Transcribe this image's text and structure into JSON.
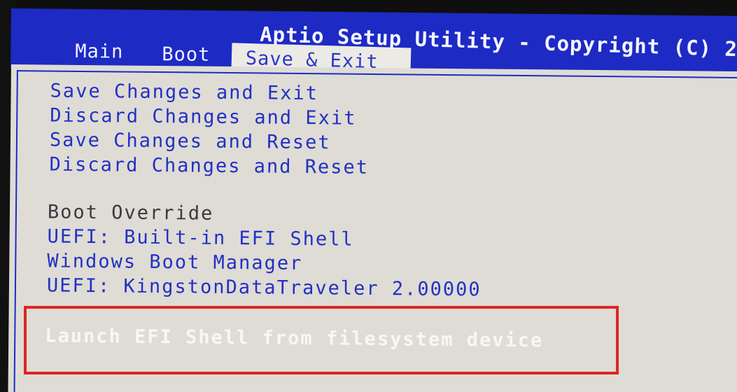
{
  "header": {
    "title": "Aptio Setup Utility - Copyright (C) 2",
    "tabs": [
      {
        "label": "Main"
      },
      {
        "label": "Boot"
      },
      {
        "label": "Save & Exit"
      }
    ]
  },
  "menu": {
    "items": [
      {
        "label": "Save Changes and Exit"
      },
      {
        "label": "Discard Changes and Exit"
      },
      {
        "label": "Save Changes and Reset"
      },
      {
        "label": "Discard Changes and Reset"
      }
    ],
    "boot_override": {
      "heading": "Boot Override",
      "options": [
        {
          "label": "UEFI: Built-in EFI Shell"
        },
        {
          "label": "Windows Boot Manager"
        },
        {
          "label": "UEFI: KingstonDataTraveler 2.00000"
        }
      ]
    },
    "selected": {
      "label": "Launch EFI Shell from filesystem device"
    }
  },
  "colors": {
    "header_blue": "#1d2ac4",
    "panel_gray": "#dedcd5",
    "item_blue": "#2430c4",
    "highlight_red": "#e02522"
  }
}
